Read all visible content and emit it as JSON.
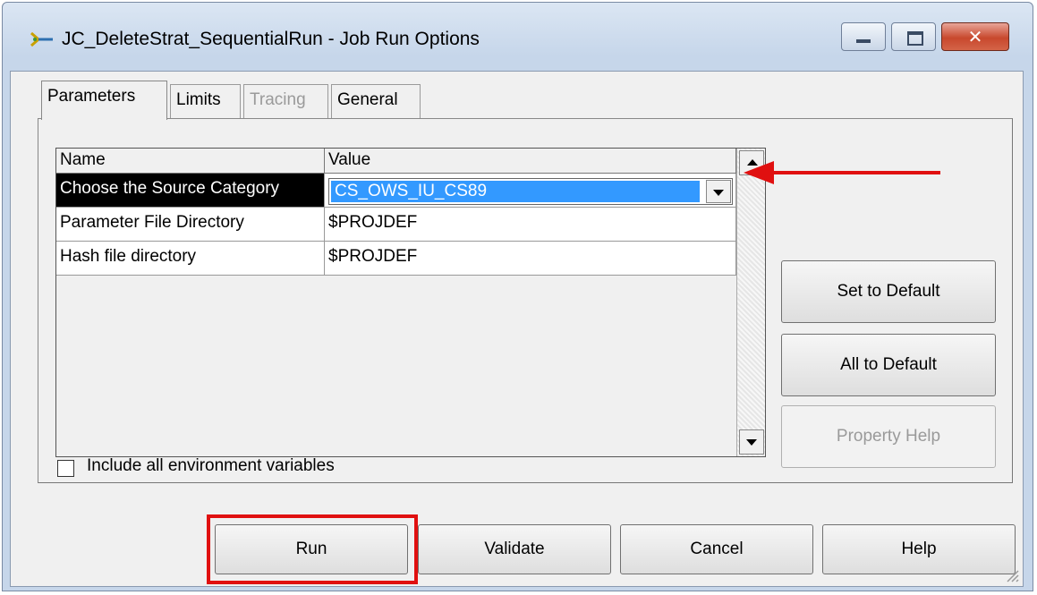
{
  "window": {
    "title": "JC_DeleteStrat_SequentialRun - Job Run Options",
    "controls": {
      "minimize": "minimize-icon",
      "maximize": "maximize-icon",
      "close": "close-icon"
    },
    "close_glyph": "✕"
  },
  "tabs": [
    {
      "label": "Parameters",
      "state": "active"
    },
    {
      "label": "Limits",
      "state": "normal"
    },
    {
      "label": "Tracing",
      "state": "disabled"
    },
    {
      "label": "General",
      "state": "normal"
    }
  ],
  "grid": {
    "headers": {
      "name": "Name",
      "value": "Value"
    },
    "rows": [
      {
        "name": "Choose the Source Category",
        "value": "CS_OWS_IU_CS89",
        "selected": true
      },
      {
        "name": "Parameter File Directory",
        "value": "$PROJDEF"
      },
      {
        "name": "Hash file directory",
        "value": "$PROJDEF"
      }
    ]
  },
  "side_buttons": {
    "set_to_default": "Set to Default",
    "all_to_default": "All to Default",
    "property_help": "Property Help"
  },
  "checkbox": {
    "label": "Include all environment variables",
    "checked": false
  },
  "bottom_buttons": {
    "run": "Run",
    "validate": "Validate",
    "cancel": "Cancel",
    "help": "Help"
  },
  "colors": {
    "selection": "#3399ff",
    "annotation": "#e01010",
    "close_button": "#c8482d"
  }
}
